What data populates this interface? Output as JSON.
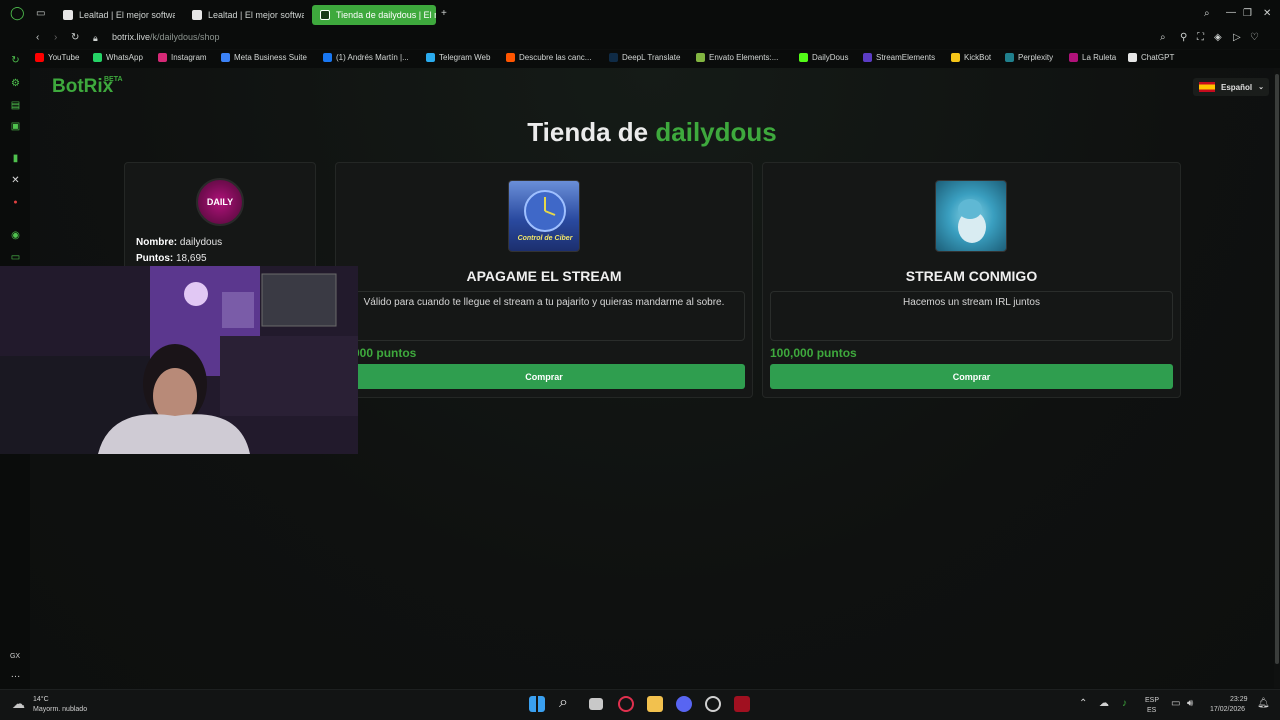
{
  "browser": {
    "tabs": [
      {
        "label": "Lealtad | El mejor software",
        "active": false
      },
      {
        "label": "Lealtad | El mejor software",
        "active": false
      },
      {
        "label": "Tienda de dailydous | El m",
        "active": true
      }
    ],
    "url_host": "botrix.live",
    "url_path": "/k/dailydous/shop",
    "bookmarks": [
      {
        "label": "YouTube",
        "color": "#ff0000"
      },
      {
        "label": "WhatsApp",
        "color": "#25d366"
      },
      {
        "label": "Instagram",
        "color": "#d62976"
      },
      {
        "label": "Meta Business Suite",
        "color": "#3b82f6"
      },
      {
        "label": "(1) Andrés Martín |...",
        "color": "#1877f2"
      },
      {
        "label": "Telegram Web",
        "color": "#2aabee"
      },
      {
        "label": "Descubre las canc...",
        "color": "#ff5500"
      },
      {
        "label": "DeepL Translate",
        "color": "#0f2b46"
      },
      {
        "label": "Envato Elements:...",
        "color": "#82b541"
      },
      {
        "label": "DailyDous",
        "color": "#53fc18"
      },
      {
        "label": "StreamElements",
        "color": "#5b3cc4"
      },
      {
        "label": "KickBot",
        "color": "#f5c518"
      },
      {
        "label": "Perplexity",
        "color": "#20808d"
      },
      {
        "label": "La Ruleta",
        "color": "#b0127a"
      },
      {
        "label": "ChatGPT",
        "color": "#e6e6e6"
      }
    ]
  },
  "site": {
    "logo": "BotRix",
    "beta": "BETA",
    "language": "Español"
  },
  "shop": {
    "title_prefix": "Tienda de",
    "title_name": "dailydous"
  },
  "user": {
    "avatar_text": "DAILY",
    "name_label": "Nombre:",
    "name_value": "dailydous",
    "points_label": "Puntos:",
    "points_value": "18,695"
  },
  "items": [
    {
      "title": "APAGAME EL STREAM",
      "image_caption": "Control de Ciber",
      "description": "Válido para cuando te llegue el stream a tu pajarito y quieras mandarme al sobre.",
      "price": "0,000 puntos",
      "button": "Comprar"
    },
    {
      "title": "STREAM CONMIGO",
      "description": "Hacemos un stream IRL juntos",
      "price": "100,000 puntos",
      "button": "Comprar"
    }
  ],
  "taskbar": {
    "weather_temp": "14°C",
    "weather_desc": "Mayorm. nublado",
    "lang_1": "ESP",
    "lang_2": "ES",
    "time": "23:29",
    "date": "17/02/2026",
    "sidebar_gx": "GX"
  },
  "colors": {
    "accent": "#3ea93d",
    "button": "#2f9e4f",
    "background": "#0d0f0e"
  }
}
